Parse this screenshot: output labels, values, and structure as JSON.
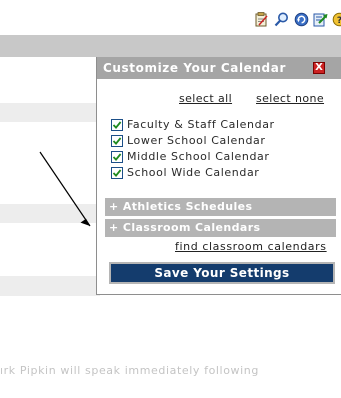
{
  "toolbar": {
    "icons": [
      "notepad-icon",
      "search-icon",
      "refresh-icon",
      "export-icon",
      "help-icon"
    ]
  },
  "panel": {
    "title": "Customize Your Calendar",
    "close_label": "X",
    "select_all": "select all",
    "select_none": "select none",
    "calendars": [
      {
        "label": "Faculty & Staff Calendar",
        "checked": true
      },
      {
        "label": "Lower School Calendar",
        "checked": true
      },
      {
        "label": "Middle School Calendar",
        "checked": true
      },
      {
        "label": "School Wide Calendar",
        "checked": true
      }
    ],
    "athletics": "+ Athletics Schedules",
    "classroom": "+ Classroom Calendars",
    "find_link": "find classroom calendars",
    "save_label": "Save Your Settings"
  },
  "background": {
    "text": "ırk Pipkin will speak immediately following"
  },
  "colors": {
    "panel_header": "#a5a5a5",
    "save_button": "#143c6d",
    "check": "#1f8a1f",
    "close": "#cc2222"
  }
}
